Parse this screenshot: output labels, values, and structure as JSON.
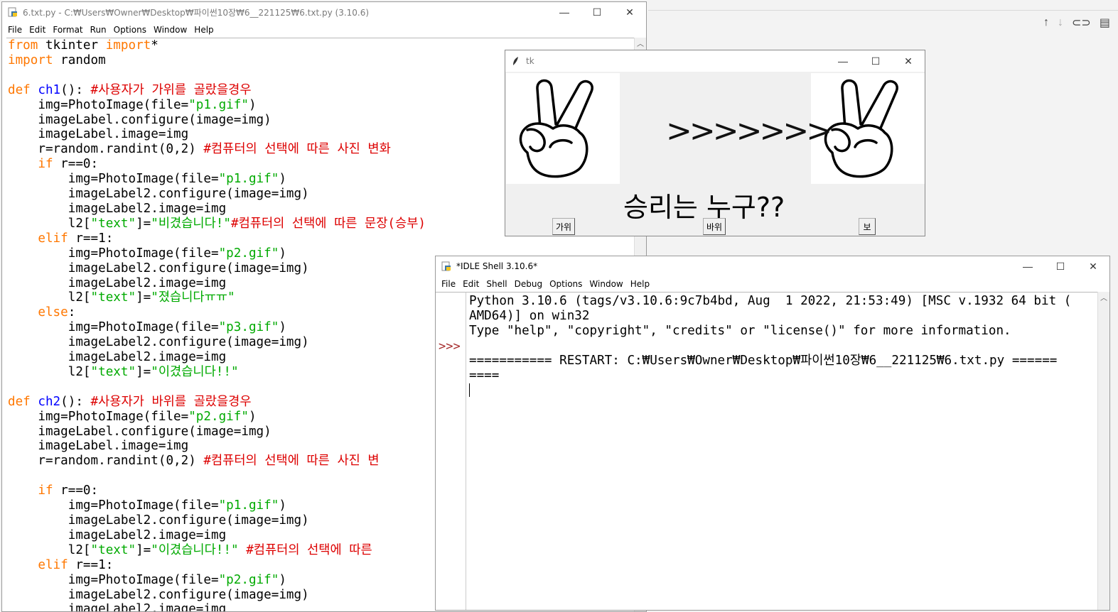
{
  "editor": {
    "title": "6.txt.py - C:₩Users₩Owner₩Desktop₩파이썬10장₩6__221125₩6.txt.py (3.10.6)",
    "menu": [
      "File",
      "Edit",
      "Format",
      "Run",
      "Options",
      "Window",
      "Help"
    ]
  },
  "tk_window": {
    "title": "tk",
    "arrows": ">>>>>>>",
    "question": "승리는 누구??",
    "buttons": {
      "scissors": "가위",
      "rock": "바위",
      "paper": "보"
    }
  },
  "shell": {
    "title": "*IDLE Shell 3.10.6*",
    "menu": [
      "File",
      "Edit",
      "Shell",
      "Debug",
      "Options",
      "Window",
      "Help"
    ],
    "prompt": ">>>",
    "lines": [
      "Python 3.10.6 (tags/v3.10.6:9c7b4bd, Aug  1 2022, 21:53:49) [MSC v.1932 64 bit (",
      "AMD64)] on win32",
      "Type \"help\", \"copyright\", \"credits\" or \"license()\" for more information.",
      "",
      "=========== RESTART: C:₩Users₩Owner₩Desktop₩파이썬10장₩6__221125₩6.txt.py ======",
      "===="
    ]
  },
  "code": [
    [
      [
        "kw",
        "from"
      ],
      [
        "t",
        " tkinter "
      ],
      [
        "kw",
        "import"
      ],
      [
        "t",
        "*"
      ]
    ],
    [
      [
        "kw",
        "import"
      ],
      [
        "t",
        " random"
      ]
    ],
    [],
    [
      [
        "kw",
        "def"
      ],
      [
        "t",
        " "
      ],
      [
        "def",
        "ch1"
      ],
      [
        "t",
        "(): "
      ],
      [
        "cm",
        "#사용자가 가위를 골랐을경우"
      ]
    ],
    [
      [
        "t",
        "    img=PhotoImage(file="
      ],
      [
        "str",
        "\"p1.gif\""
      ],
      [
        "t",
        ")"
      ]
    ],
    [
      [
        "t",
        "    imageLabel.configure(image=img)"
      ]
    ],
    [
      [
        "t",
        "    imageLabel.image=img"
      ]
    ],
    [
      [
        "t",
        "    r=random.randint(0,2) "
      ],
      [
        "cm",
        "#컴퓨터의 선택에 따른 사진 변화"
      ]
    ],
    [
      [
        "t",
        "    "
      ],
      [
        "kw",
        "if"
      ],
      [
        "t",
        " r==0:"
      ]
    ],
    [
      [
        "t",
        "        img=PhotoImage(file="
      ],
      [
        "str",
        "\"p1.gif\""
      ],
      [
        "t",
        ")"
      ]
    ],
    [
      [
        "t",
        "        imageLabel2.configure(image=img)"
      ]
    ],
    [
      [
        "t",
        "        imageLabel2.image=img"
      ]
    ],
    [
      [
        "t",
        "        l2["
      ],
      [
        "str",
        "\"text\""
      ],
      [
        "t",
        "]="
      ],
      [
        "str",
        "\"비겼습니다!\""
      ],
      [
        "cm",
        "#컴퓨터의 선택에 따른 문장(승부)"
      ]
    ],
    [
      [
        "t",
        "    "
      ],
      [
        "kw",
        "elif"
      ],
      [
        "t",
        " r==1:"
      ]
    ],
    [
      [
        "t",
        "        img=PhotoImage(file="
      ],
      [
        "str",
        "\"p2.gif\""
      ],
      [
        "t",
        ")"
      ]
    ],
    [
      [
        "t",
        "        imageLabel2.configure(image=img)"
      ]
    ],
    [
      [
        "t",
        "        imageLabel2.image=img"
      ]
    ],
    [
      [
        "t",
        "        l2["
      ],
      [
        "str",
        "\"text\""
      ],
      [
        "t",
        "]="
      ],
      [
        "str",
        "\"졌습니다ㅠㅠ\""
      ]
    ],
    [
      [
        "t",
        "    "
      ],
      [
        "kw",
        "else"
      ],
      [
        "t",
        ":"
      ]
    ],
    [
      [
        "t",
        "        img=PhotoImage(file="
      ],
      [
        "str",
        "\"p3.gif\""
      ],
      [
        "t",
        ")"
      ]
    ],
    [
      [
        "t",
        "        imageLabel2.configure(image=img)"
      ]
    ],
    [
      [
        "t",
        "        imageLabel2.image=img"
      ]
    ],
    [
      [
        "t",
        "        l2["
      ],
      [
        "str",
        "\"text\""
      ],
      [
        "t",
        "]="
      ],
      [
        "str",
        "\"이겼습니다!!\""
      ]
    ],
    [],
    [
      [
        "kw",
        "def"
      ],
      [
        "t",
        " "
      ],
      [
        "def",
        "ch2"
      ],
      [
        "t",
        "(): "
      ],
      [
        "cm",
        "#사용자가 바위를 골랐을경우"
      ]
    ],
    [
      [
        "t",
        "    img=PhotoImage(file="
      ],
      [
        "str",
        "\"p2.gif\""
      ],
      [
        "t",
        ")"
      ]
    ],
    [
      [
        "t",
        "    imageLabel.configure(image=img)"
      ]
    ],
    [
      [
        "t",
        "    imageLabel.image=img"
      ]
    ],
    [
      [
        "t",
        "    r=random.randint(0,2) "
      ],
      [
        "cm",
        "#컴퓨터의 선택에 따른 사진 변"
      ]
    ],
    [],
    [
      [
        "t",
        "    "
      ],
      [
        "kw",
        "if"
      ],
      [
        "t",
        " r==0:"
      ]
    ],
    [
      [
        "t",
        "        img=PhotoImage(file="
      ],
      [
        "str",
        "\"p1.gif\""
      ],
      [
        "t",
        ")"
      ]
    ],
    [
      [
        "t",
        "        imageLabel2.configure(image=img)"
      ]
    ],
    [
      [
        "t",
        "        imageLabel2.image=img"
      ]
    ],
    [
      [
        "t",
        "        l2["
      ],
      [
        "str",
        "\"text\""
      ],
      [
        "t",
        "]="
      ],
      [
        "str",
        "\"이겼습니다!!\""
      ],
      [
        "t",
        " "
      ],
      [
        "cm",
        "#컴퓨터의 선택에 따른"
      ]
    ],
    [
      [
        "t",
        "    "
      ],
      [
        "kw",
        "elif"
      ],
      [
        "t",
        " r==1:"
      ]
    ],
    [
      [
        "t",
        "        img=PhotoImage(file="
      ],
      [
        "str",
        "\"p2.gif\""
      ],
      [
        "t",
        ")"
      ]
    ],
    [
      [
        "t",
        "        imageLabel2.configure(image=img)"
      ]
    ],
    [
      [
        "t",
        "        imageLabel2.image=img"
      ]
    ]
  ],
  "colors": {
    "keyword": "#ff7700",
    "string": "#00aa00",
    "comment": "#dd0000",
    "defname": "#0000ff",
    "prompt": "#a52a2a"
  }
}
